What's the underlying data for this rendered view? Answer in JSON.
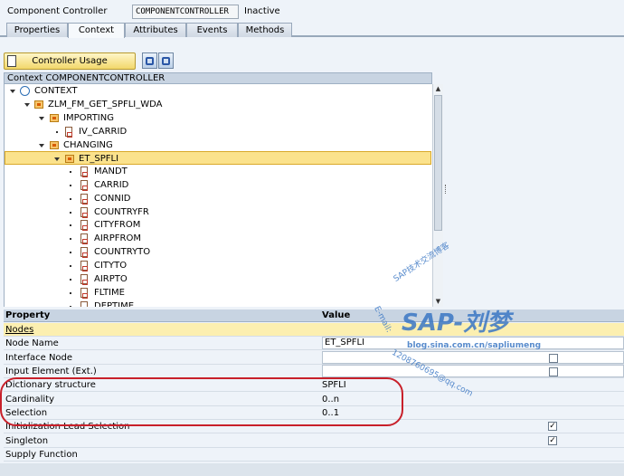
{
  "header": {
    "label": "Component Controller",
    "component_name": "COMPONENTCONTROLLER",
    "status": "Inactive"
  },
  "tabs": [
    {
      "label": "Properties",
      "active": false
    },
    {
      "label": "Context",
      "active": true
    },
    {
      "label": "Attributes",
      "active": false
    },
    {
      "label": "Events",
      "active": false
    },
    {
      "label": "Methods",
      "active": false
    }
  ],
  "toolbar": {
    "controller_usage_label": "Controller Usage",
    "icon1": "binoculars-icon",
    "icon2": "find-next-icon"
  },
  "tree": {
    "header": "Context COMPONENTCONTROLLER",
    "nodes": [
      {
        "label": "CONTEXT",
        "type": "context"
      },
      {
        "label": "ZLM_FM_GET_SPFLI_WDA",
        "type": "node"
      },
      {
        "label": "IMPORTING",
        "type": "node"
      },
      {
        "label": "IV_CARRID",
        "type": "attribute"
      },
      {
        "label": "CHANGING",
        "type": "node"
      },
      {
        "label": "ET_SPFLI",
        "type": "node",
        "selected": true
      },
      {
        "label": "MANDT",
        "type": "attribute"
      },
      {
        "label": "CARRID",
        "type": "attribute"
      },
      {
        "label": "CONNID",
        "type": "attribute"
      },
      {
        "label": "COUNTRYFR",
        "type": "attribute"
      },
      {
        "label": "CITYFROM",
        "type": "attribute"
      },
      {
        "label": "AIRPFROM",
        "type": "attribute"
      },
      {
        "label": "COUNTRYTO",
        "type": "attribute"
      },
      {
        "label": "CITYTO",
        "type": "attribute"
      },
      {
        "label": "AIRPTO",
        "type": "attribute"
      },
      {
        "label": "FLTIME",
        "type": "attribute"
      },
      {
        "label": "DEPTIME",
        "type": "attribute"
      }
    ]
  },
  "properties": {
    "col_property": "Property",
    "col_value": "Value",
    "group": "Nodes",
    "rows": [
      {
        "name": "Node Name",
        "value": "ET_SPFLI",
        "kind": "input"
      },
      {
        "name": "Interface Node",
        "value": "",
        "kind": "checkbox",
        "checked": false
      },
      {
        "name": "Input Element (Ext.)",
        "value": "",
        "kind": "checkbox",
        "checked": false
      },
      {
        "name": "Dictionary structure",
        "value": "SPFLI",
        "kind": "input"
      },
      {
        "name": "Cardinality",
        "value": "0..n",
        "kind": "input"
      },
      {
        "name": "Selection",
        "value": "0..1",
        "kind": "input"
      },
      {
        "name": "Initialization Lead Selection",
        "value": "",
        "kind": "checkbox",
        "checked": true
      },
      {
        "name": "Singleton",
        "value": "",
        "kind": "checkbox",
        "checked": true
      },
      {
        "name": "Supply Function",
        "value": "",
        "kind": "text"
      }
    ]
  },
  "watermark": {
    "line1": "SAP技术交流博客",
    "brand": "SAP-刘梦",
    "blog": "blog.sina.com.cn/sapliumeng",
    "email_label": "E-mail:",
    "email": "1208760695@qq.com"
  }
}
